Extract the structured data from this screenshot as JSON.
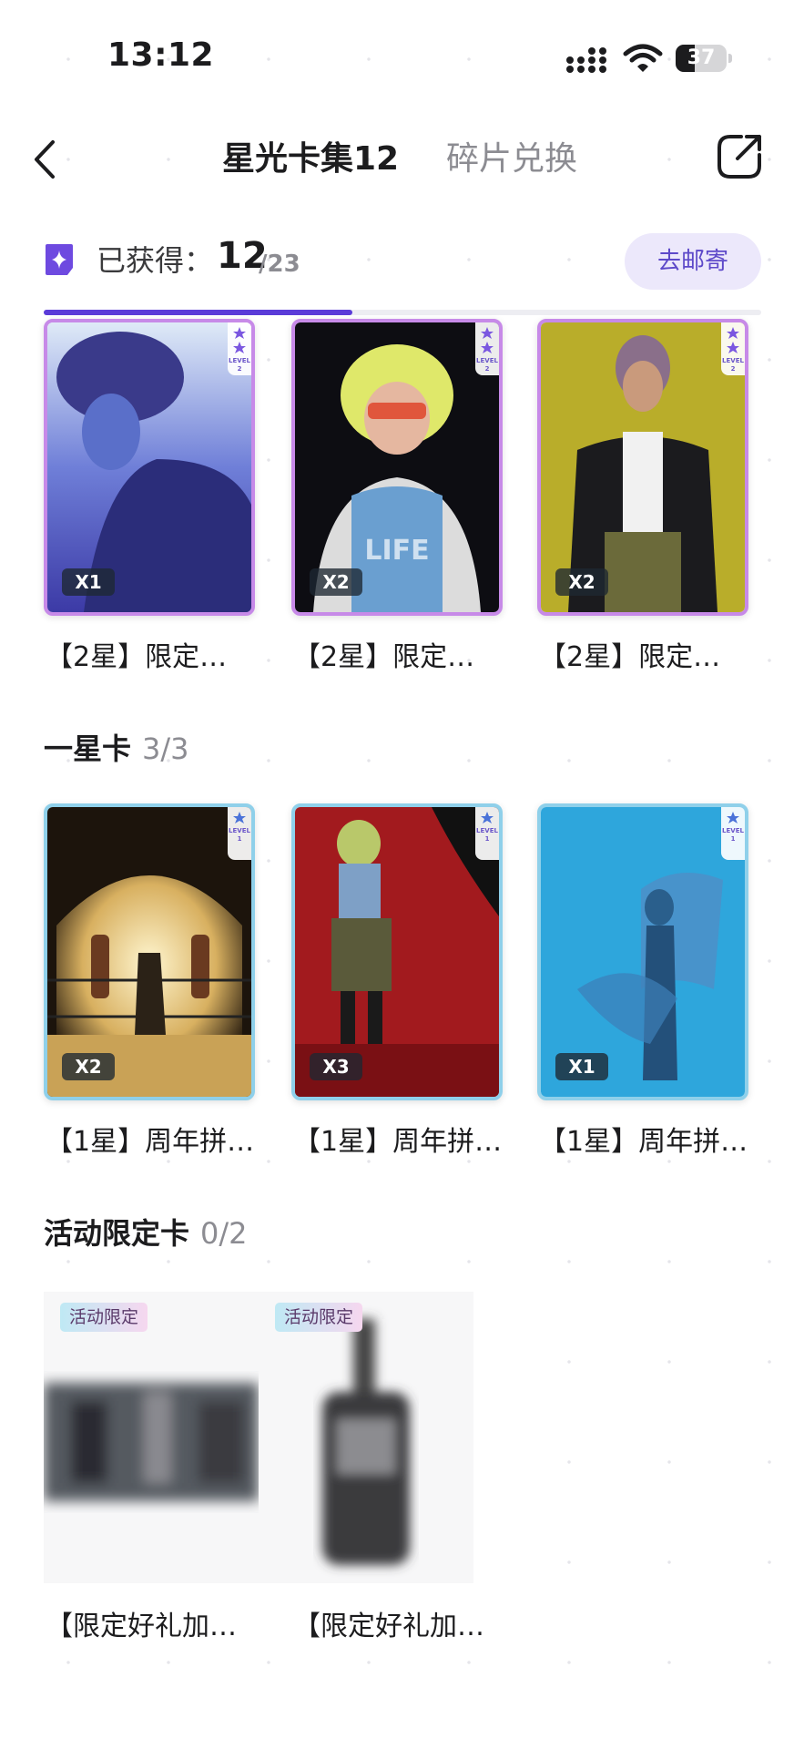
{
  "status_bar": {
    "time": "13:12",
    "battery": "37",
    "battery_level": 0.37
  },
  "nav": {
    "tab_active": "星光卡集12",
    "tab_inactive": "碎片兑换"
  },
  "summary": {
    "obtained_label": "已获得：",
    "obtained_count": "12",
    "obtained_total": "/23",
    "mail_button": "去邮寄",
    "progress": 0.43
  },
  "two_star": {
    "cards": [
      {
        "qty": "X1",
        "label": "【2星】限定…",
        "level": "LEVEL 2"
      },
      {
        "qty": "X2",
        "label": "【2星】限定…",
        "level": "LEVEL 2"
      },
      {
        "qty": "X2",
        "label": "【2星】限定…",
        "level": "LEVEL 2"
      }
    ]
  },
  "one_star": {
    "title": "一星卡",
    "count": "3/3",
    "cards": [
      {
        "qty": "X2",
        "label": "【1星】周年拼…",
        "level": "LEVEL 1"
      },
      {
        "qty": "X3",
        "label": "【1星】周年拼…",
        "level": "LEVEL 1"
      },
      {
        "qty": "X1",
        "label": "【1星】周年拼…",
        "level": "LEVEL 1"
      }
    ]
  },
  "event": {
    "title": "活动限定卡",
    "count": "0/2",
    "cards": [
      {
        "badge": "活动限定",
        "label": "【限定好礼加…"
      },
      {
        "badge": "活动限定",
        "label": "【限定好礼加…"
      }
    ]
  },
  "colors": {
    "accent": "#5a3bd8",
    "two_star_border": "#c78ae8",
    "one_star_border": "#8fd0ea"
  },
  "icons": {
    "back": "chevron-left-icon",
    "share": "share-icon",
    "star_collection": "sparkle-icon"
  }
}
